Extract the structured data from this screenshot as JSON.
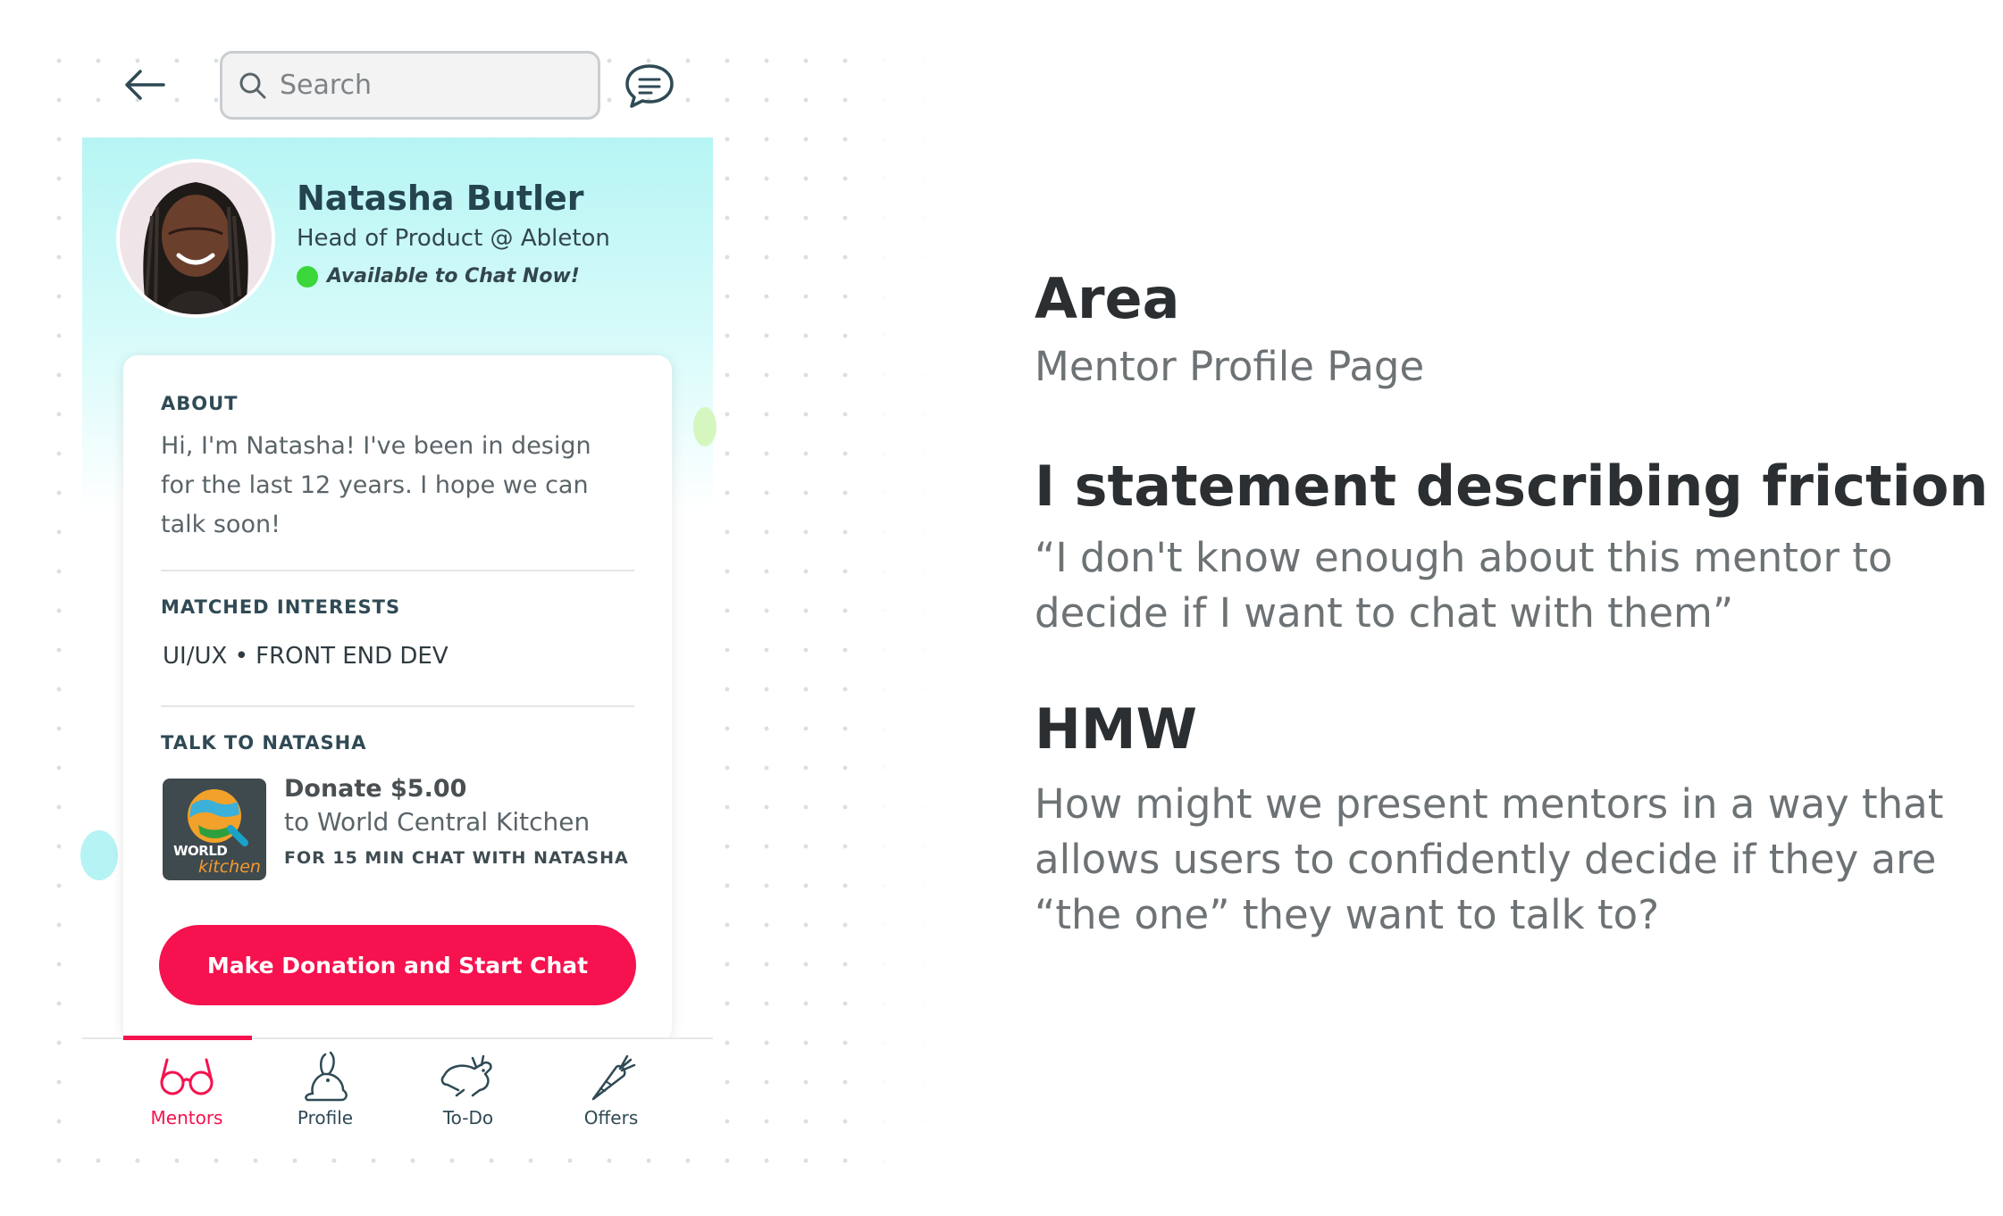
{
  "search": {
    "placeholder": "Search"
  },
  "mentor": {
    "name": "Natasha Butler",
    "title": "Head of Product @ Ableton",
    "status": "Available to Chat Now!"
  },
  "about": {
    "heading": "ABOUT",
    "text": "Hi, I'm Natasha! I've been in design for the last 12 years. I hope we can talk soon!"
  },
  "interests": {
    "heading": "MATCHED INTERESTS",
    "items": "UI/UX • FRONT END DEV"
  },
  "talk": {
    "heading": "TALK TO NATASHA",
    "logo_text_1": "WORLD",
    "logo_text_2": "kitchen",
    "amount": "Donate $5.00",
    "recipient": "to World Central Kitchen",
    "note": "FOR 15 MIN CHAT WITH NATASHA",
    "cta": "Make Donation and Start Chat"
  },
  "tabs": [
    {
      "label": "Mentors",
      "icon": "glasses-icon",
      "active": true
    },
    {
      "label": "Profile",
      "icon": "rabbit-icon",
      "active": false
    },
    {
      "label": "To-Do",
      "icon": "running-rabbit-icon",
      "active": false
    },
    {
      "label": "Offers",
      "icon": "carrot-icon",
      "active": false
    }
  ],
  "colors": {
    "accent": "#f5124e",
    "header_gradient": "#b6f5f4",
    "status_green": "#3ad63a"
  },
  "notes": {
    "area_heading": "Area",
    "area_value": "Mentor Profile Page",
    "friction_heading": "I statement describing friction",
    "friction_value": "“I don't know enough about this mentor to decide if I want to chat with them”",
    "hmw_heading": "HMW",
    "hmw_value": "How might we present mentors in a way that allows users to confidently decide if they are “the one” they want to talk to?"
  }
}
